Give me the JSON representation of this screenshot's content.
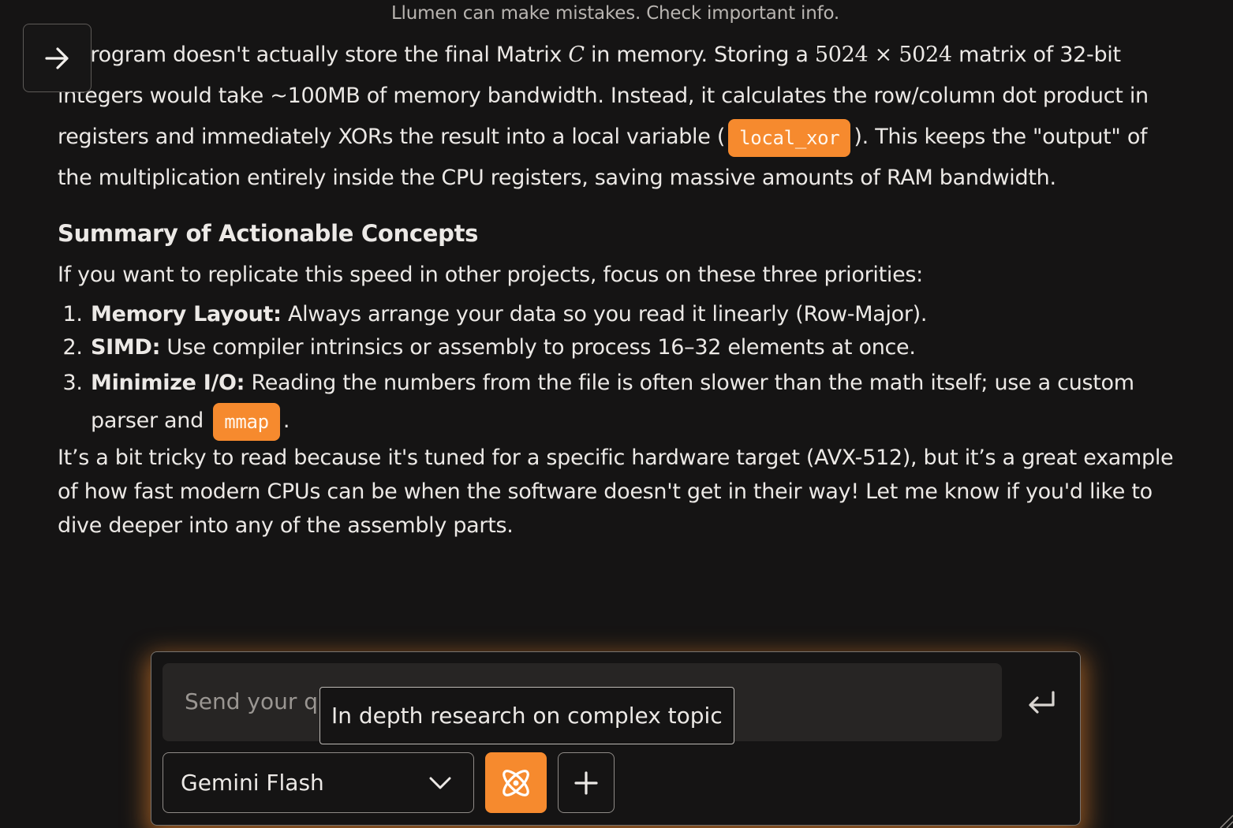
{
  "disclaimer": "Llumen can make mistakes. Check important info.",
  "message": {
    "p1_a": "e program doesn't actually store the final Matrix ",
    "p1_matrix_var": "C",
    "p1_b": " in memory. Storing a ",
    "p1_size": "5024 × 5024",
    "p1_c": " matrix of 32-bit integers would take ~100MB of memory bandwidth. Instead, it calculates the row/column dot product in registers and immediately XORs the result into a local variable (",
    "p1_code": "local_xor",
    "p1_d": "). This keeps the \"output\" of the multiplication entirely inside the CPU registers, saving massive amounts of RAM bandwidth.",
    "heading": "Summary of Actionable Concepts",
    "intro": "If you want to replicate this speed in other projects, focus on these three priorities:",
    "items": [
      {
        "label": "Memory Layout:",
        "text": " Always arrange your data so you read it linearly (Row-Major)."
      },
      {
        "label": "SIMD:",
        "text": " Use compiler intrinsics or assembly to process 16–32 elements at once."
      },
      {
        "label": "Minimize I/O:",
        "text": " Reading the numbers from the file is often slower than the math itself; use a custom parser and ",
        "code": "mmap",
        "tail": "."
      }
    ],
    "closing": "It’s a bit tricky to read because it's tuned for a specific hardware target (AVX-512), but it’s a great example of how fast modern CPUs can be when the software doesn't get in their way! Let me know if you'd like to dive deeper into any of the assembly parts."
  },
  "composer": {
    "placeholder": "Send your qu",
    "tooltip": "In depth research on complex topic",
    "model": "Gemini Flash"
  },
  "icons": {
    "toggle": "arrow-right-icon",
    "send": "enter-return-icon",
    "model_dropdown": "chevron-down-icon",
    "research": "atom-icon",
    "add": "plus-icon",
    "resize": "resize-handle-icon"
  },
  "colors": {
    "background": "#151414",
    "accent": "#f68a2e",
    "text": "#ece9e6",
    "input_bg": "#272524"
  }
}
